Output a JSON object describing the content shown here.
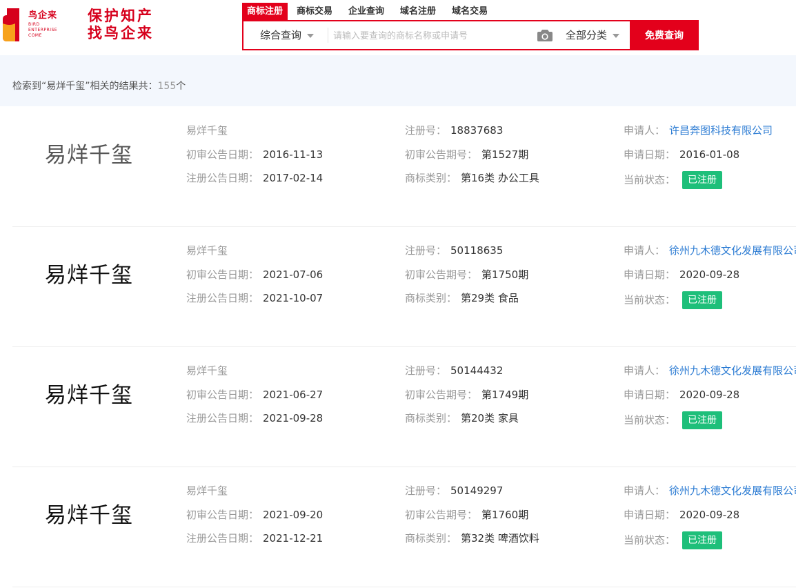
{
  "brand": {
    "name_cn": "鸟企来",
    "name_en_lines": [
      "BIRD",
      "ENTERPRISE",
      "COME"
    ],
    "slogan_lines": [
      "保护知产",
      "找鸟企来"
    ],
    "color": "#d6001c"
  },
  "nav": {
    "tabs": [
      {
        "label": "商标注册",
        "active": true
      },
      {
        "label": "商标交易",
        "active": false
      },
      {
        "label": "企业查询",
        "active": false
      },
      {
        "label": "域名注册",
        "active": false
      },
      {
        "label": "域名交易",
        "active": false
      }
    ]
  },
  "search": {
    "type_label": "综合查询",
    "placeholder": "请输入要查询的商标名称或申请号",
    "category_label": "全部分类",
    "button_label": "免费查询",
    "icon": "camera-icon",
    "accent": "#e3001b"
  },
  "summary": {
    "prefix": "检索到“易烊千玺”相关的结果共：",
    "count": "155",
    "suffix": "个"
  },
  "labels": {
    "reg_no": "注册号：",
    "prelim_date": "初审公告日期：",
    "prelim_issue": "初审公告期号：",
    "reg_date": "注册公告日期：",
    "class": "商标类别：",
    "applicant": "申请人：",
    "apply_date": "申请日期：",
    "status": "当前状态："
  },
  "results": [
    {
      "mark": "易烊千玺",
      "name": "易烊千玺",
      "reg_no": "18837683",
      "applicant": "许昌奔图科技有限公司",
      "prelim_date": "2016-11-13",
      "prelim_issue": "第1527期",
      "apply_date": "2016-01-08",
      "reg_date": "2017-02-14",
      "class": "第16类 办公工具",
      "status": "已注册"
    },
    {
      "mark": "易烊千玺",
      "name": "易烊千玺",
      "reg_no": "50118635",
      "applicant": "徐州九木德文化发展有限公司",
      "prelim_date": "2021-07-06",
      "prelim_issue": "第1750期",
      "apply_date": "2020-09-28",
      "reg_date": "2021-10-07",
      "class": "第29类 食品",
      "status": "已注册"
    },
    {
      "mark": "易烊千玺",
      "name": "易烊千玺",
      "reg_no": "50144432",
      "applicant": "徐州九木德文化发展有限公司",
      "prelim_date": "2021-06-27",
      "prelim_issue": "第1749期",
      "apply_date": "2020-09-28",
      "reg_date": "2021-09-28",
      "class": "第20类 家具",
      "status": "已注册"
    },
    {
      "mark": "易烊千玺",
      "name": "易烊千玺",
      "reg_no": "50149297",
      "applicant": "徐州九木德文化发展有限公司",
      "prelim_date": "2021-09-20",
      "prelim_issue": "第1760期",
      "apply_date": "2020-09-28",
      "reg_date": "2021-12-21",
      "class": "第32类 啤酒饮料",
      "status": "已注册"
    }
  ]
}
